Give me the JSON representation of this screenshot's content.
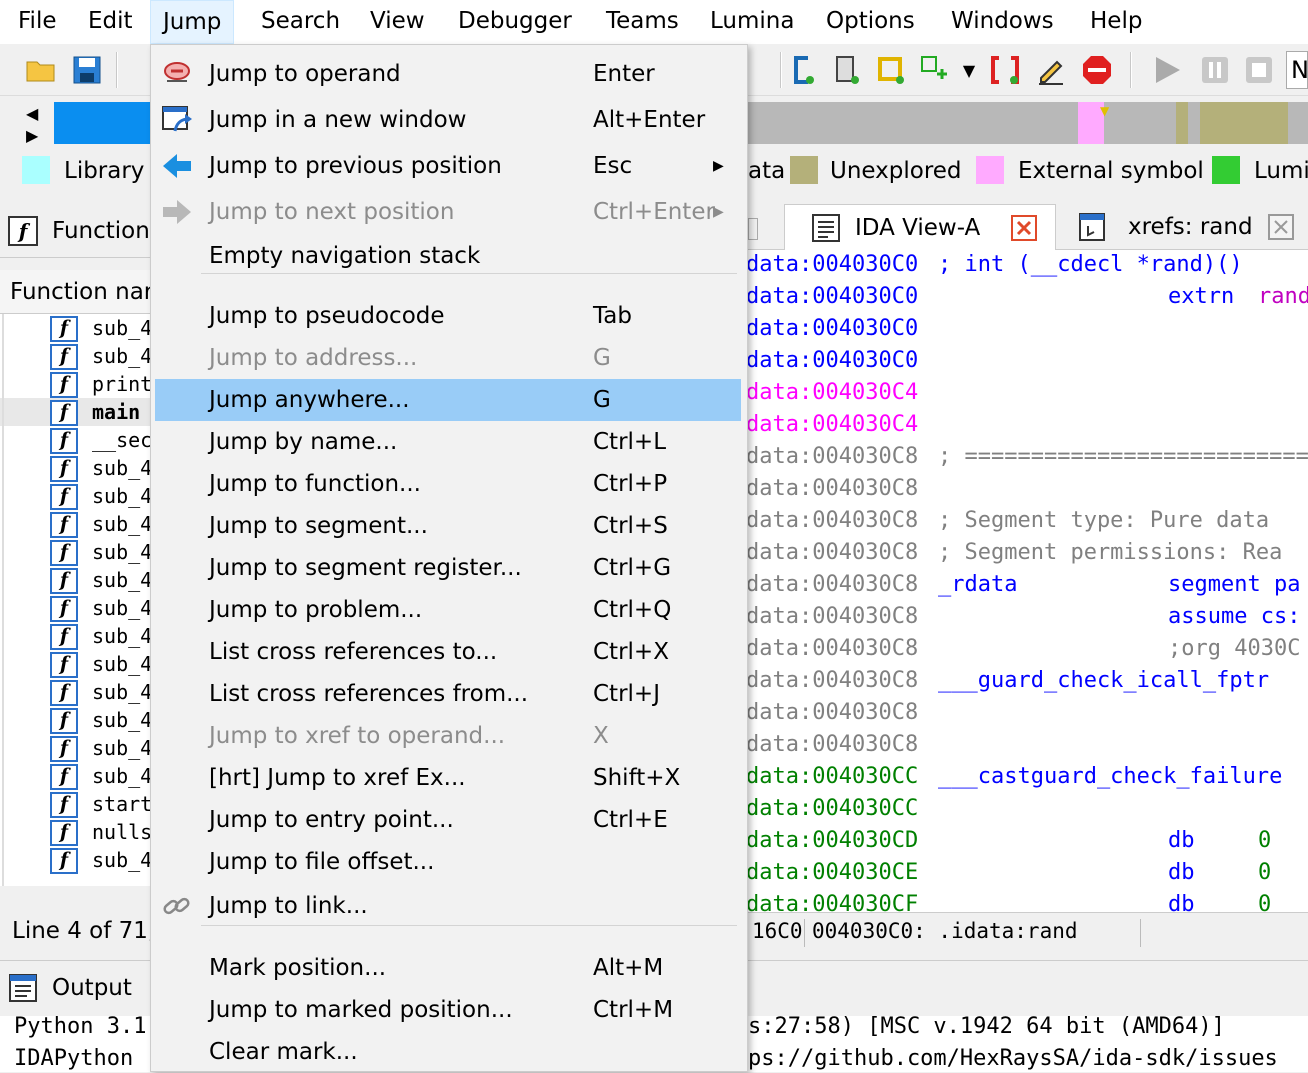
{
  "menubar": {
    "items": [
      "File",
      "Edit",
      "Jump",
      "Search",
      "View",
      "Debugger",
      "Teams",
      "Lumina",
      "Options",
      "Windows",
      "Help"
    ]
  },
  "legend": {
    "library_label": "Library",
    "data_label": "ata",
    "unexplored_label": "Unexplored",
    "external_label": "External symbol",
    "lumina_label": "Lumi",
    "colors": {
      "library": "#aaffff",
      "data": "#c0bb7a",
      "unexplored": "#b4b07a",
      "external": "#ffaaff",
      "lumina": "#33cc33"
    }
  },
  "left_panel": {
    "tab_label": "Function",
    "header": "Function nar",
    "functions": [
      "sub_4",
      "sub_4",
      "print",
      "main",
      "__sec",
      "sub_4",
      "sub_4",
      "sub_4",
      "sub_4",
      "sub_4",
      "sub_4",
      "sub_4",
      "sub_4",
      "sub_4",
      "sub_4",
      "sub_4",
      "sub_4",
      "start",
      "nulls",
      "sub_4"
    ],
    "status": "Line 4 of 71,"
  },
  "output": {
    "tab_label": "Output",
    "line1_left": "Python 3.1",
    "line1_right": "s:27:58) [MSC v.1942 64 bit (AMD64)]",
    "line2_left": "IDAPython",
    "line2_right": "ps://github.com/HexRaysSA/ida-sdk/issues"
  },
  "code_view": {
    "tab_prev": "ata",
    "tab_active": "IDA View-A",
    "tab_xrefs": "xrefs: rand",
    "lines": [
      {
        "addr": "data:004030C0",
        "c1": "; int (__cdecl *rand)()",
        "c2": "",
        "c3": "",
        "addr_color": "#0000ff",
        "c1_color": "#0000ff"
      },
      {
        "addr": "data:004030C0",
        "c1": "",
        "c2": "extrn",
        "c3": "rand",
        "addr_color": "#0000ff"
      },
      {
        "addr": "data:004030C0",
        "c1": "",
        "c2": "",
        "c3": "",
        "addr_color": "#0000ff"
      },
      {
        "addr": "data:004030C0",
        "c1": "",
        "c2": "",
        "c3": "",
        "addr_color": "#0000ff"
      },
      {
        "addr": "data:004030C4",
        "c1": "",
        "c2": "",
        "c3": "",
        "addr_color": "#ff00ff"
      },
      {
        "addr": "data:004030C4",
        "c1": "",
        "c2": "",
        "c3": "",
        "addr_color": "#ff00ff"
      },
      {
        "addr": "data:004030C8",
        "c1": "; ===========================",
        "c2": "",
        "c3": "",
        "addr_color": "#808080",
        "c1_color": "#808080"
      },
      {
        "addr": "data:004030C8",
        "c1": "",
        "c2": "",
        "c3": "",
        "addr_color": "#808080"
      },
      {
        "addr": "data:004030C8",
        "c1": "; Segment type: Pure data",
        "c2": "",
        "c3": "",
        "addr_color": "#808080",
        "c1_color": "#808080"
      },
      {
        "addr": "data:004030C8",
        "c1": "; Segment permissions: Rea",
        "c2": "",
        "c3": "",
        "addr_color": "#808080",
        "c1_color": "#808080"
      },
      {
        "addr": "data:004030C8",
        "c1": "_rdata",
        "c2": "segment pa",
        "c3": "",
        "addr_color": "#808080",
        "c1_color": "#0000ff"
      },
      {
        "addr": "data:004030C8",
        "c1": "",
        "c2": "assume cs:",
        "c3": "",
        "addr_color": "#808080"
      },
      {
        "addr": "data:004030C8",
        "c1": "",
        "c2": ";org 4030C",
        "c3": "",
        "addr_color": "#808080",
        "c2_color": "#808080"
      },
      {
        "addr": "data:004030C8",
        "c1": "___guard_check_icall_fptr",
        "c2": "",
        "c3": "",
        "addr_color": "#808080",
        "c1_color": "#0000ff"
      },
      {
        "addr": "data:004030C8",
        "c1": "",
        "c2": "",
        "c3": "",
        "addr_color": "#808080"
      },
      {
        "addr": "data:004030C8",
        "c1": "",
        "c2": "",
        "c3": "",
        "addr_color": "#808080"
      },
      {
        "addr": "data:004030CC",
        "c1": "___castguard_check_failure",
        "c2": "",
        "c3": "",
        "addr_color": "#008000",
        "c1_color": "#0000ff"
      },
      {
        "addr": "data:004030CC",
        "c1": "",
        "c2": "",
        "c3": "",
        "addr_color": "#008000"
      },
      {
        "addr": "data:004030CD",
        "c1": "",
        "c2": "db",
        "c3": "0",
        "addr_color": "#008000"
      },
      {
        "addr": "data:004030CE",
        "c1": "",
        "c2": "db",
        "c3": "0",
        "addr_color": "#008000"
      },
      {
        "addr": "data:004030CF",
        "c1": "",
        "c2": "db",
        "c3": "0",
        "addr_color": "#008000"
      }
    ],
    "status_left": "16C0",
    "status_right": "004030C0: .idata:rand"
  },
  "jump_menu": {
    "items": [
      {
        "label": "Jump to operand",
        "shortcut": "Enter",
        "icon": "operand-icon",
        "disabled": false
      },
      {
        "label": "Jump in a new window",
        "shortcut": "Alt+Enter",
        "icon": "new-window-icon",
        "disabled": false
      },
      {
        "label": "Jump to previous position",
        "shortcut": "Esc",
        "icon": "back-arrow-icon",
        "disabled": false,
        "submenu": true
      },
      {
        "label": "Jump to next position",
        "shortcut": "Ctrl+Enter",
        "icon": "forward-arrow-icon",
        "disabled": true,
        "submenu": true
      },
      {
        "label": "Empty navigation stack",
        "shortcut": "",
        "icon": "",
        "disabled": false
      },
      {
        "label": "Jump to pseudocode",
        "shortcut": "Tab",
        "icon": "",
        "disabled": false
      },
      {
        "label": "Jump to address...",
        "shortcut": "G",
        "icon": "",
        "disabled": true
      },
      {
        "label": "Jump anywhere...",
        "shortcut": "G",
        "icon": "",
        "disabled": false,
        "highlighted": true
      },
      {
        "label": "Jump by name...",
        "shortcut": "Ctrl+L",
        "icon": "",
        "disabled": false
      },
      {
        "label": "Jump to function...",
        "shortcut": "Ctrl+P",
        "icon": "",
        "disabled": false
      },
      {
        "label": "Jump to segment...",
        "shortcut": "Ctrl+S",
        "icon": "",
        "disabled": false
      },
      {
        "label": "Jump to segment register...",
        "shortcut": "Ctrl+G",
        "icon": "",
        "disabled": false
      },
      {
        "label": "Jump to problem...",
        "shortcut": "Ctrl+Q",
        "icon": "",
        "disabled": false
      },
      {
        "label": "List cross references to...",
        "shortcut": "Ctrl+X",
        "icon": "",
        "disabled": false
      },
      {
        "label": "List cross references from...",
        "shortcut": "Ctrl+J",
        "icon": "",
        "disabled": false
      },
      {
        "label": "Jump to xref to operand...",
        "shortcut": "X",
        "icon": "",
        "disabled": true
      },
      {
        "label": "[hrt] Jump to xref Ex...",
        "shortcut": "Shift+X",
        "icon": "",
        "disabled": false
      },
      {
        "label": "Jump to entry point...",
        "shortcut": "Ctrl+E",
        "icon": "",
        "disabled": false
      },
      {
        "label": "Jump to file offset...",
        "shortcut": "",
        "icon": "",
        "disabled": false
      },
      {
        "label": "Jump to link...",
        "shortcut": "",
        "icon": "link-icon",
        "disabled": false
      },
      {
        "label": "Mark position...",
        "shortcut": "Alt+M",
        "icon": "",
        "disabled": false
      },
      {
        "label": "Jump to marked position...",
        "shortcut": "Ctrl+M",
        "icon": "",
        "disabled": false
      },
      {
        "label": "Clear mark...",
        "shortcut": "",
        "icon": "",
        "disabled": false
      }
    ]
  },
  "toolbar": {
    "right_label": "N"
  }
}
